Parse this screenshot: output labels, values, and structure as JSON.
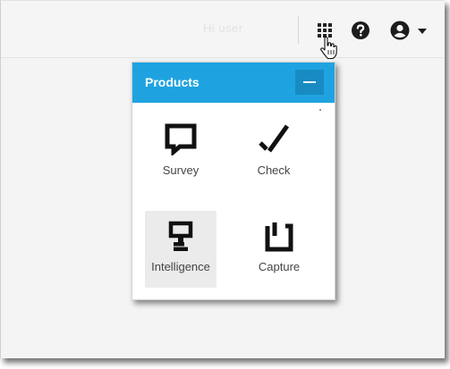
{
  "header": {
    "faded_text": "Hi user",
    "apps_icon": "grid-icon",
    "help_icon": "help-icon",
    "account_icon": "account-icon"
  },
  "panel": {
    "title": "Products",
    "collapse_icon": "minus-icon",
    "accent_color": "#1fa3e0",
    "items": [
      {
        "label": "Survey",
        "icon": "survey-icon"
      },
      {
        "label": "Check",
        "icon": "check-icon"
      },
      {
        "label": "Intelligence",
        "icon": "intelligence-icon",
        "selected": true
      },
      {
        "label": "Capture",
        "icon": "capture-icon"
      }
    ]
  }
}
